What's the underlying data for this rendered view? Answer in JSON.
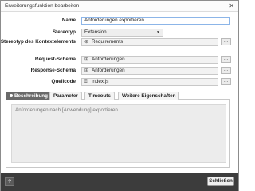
{
  "window": {
    "title": "Erweiterungsfunktion bearbeiten",
    "close_glyph": "✕"
  },
  "form": {
    "name_label": "Name",
    "name_value": "Anforderungen exportieren",
    "stereotype_label": "Stereotyp",
    "stereotype_value": "Extension",
    "context_label": "Stereotyp des Kontextelements",
    "context_value": "Requirements",
    "request_label": "Request-Schema",
    "request_value": "Anforderungen",
    "response_label": "Response-Schema",
    "response_value": "Anforderungen",
    "source_label": "Quellcode",
    "source_value": "index.js",
    "browse_label": "..."
  },
  "tabs": [
    {
      "label": "Beschreibung",
      "active": true
    },
    {
      "label": "Parameter",
      "active": false
    },
    {
      "label": "Timeouts",
      "active": false
    },
    {
      "label": "Weitere Eigenschaften",
      "active": false
    }
  ],
  "description": {
    "value": "Anforderungen nach [Anwendung] exportieren"
  },
  "footer": {
    "help_label": "?",
    "close_label": "Schließen"
  },
  "icons": {
    "context": "element-icon",
    "schema": "schema-icon",
    "source": "code-icon"
  }
}
